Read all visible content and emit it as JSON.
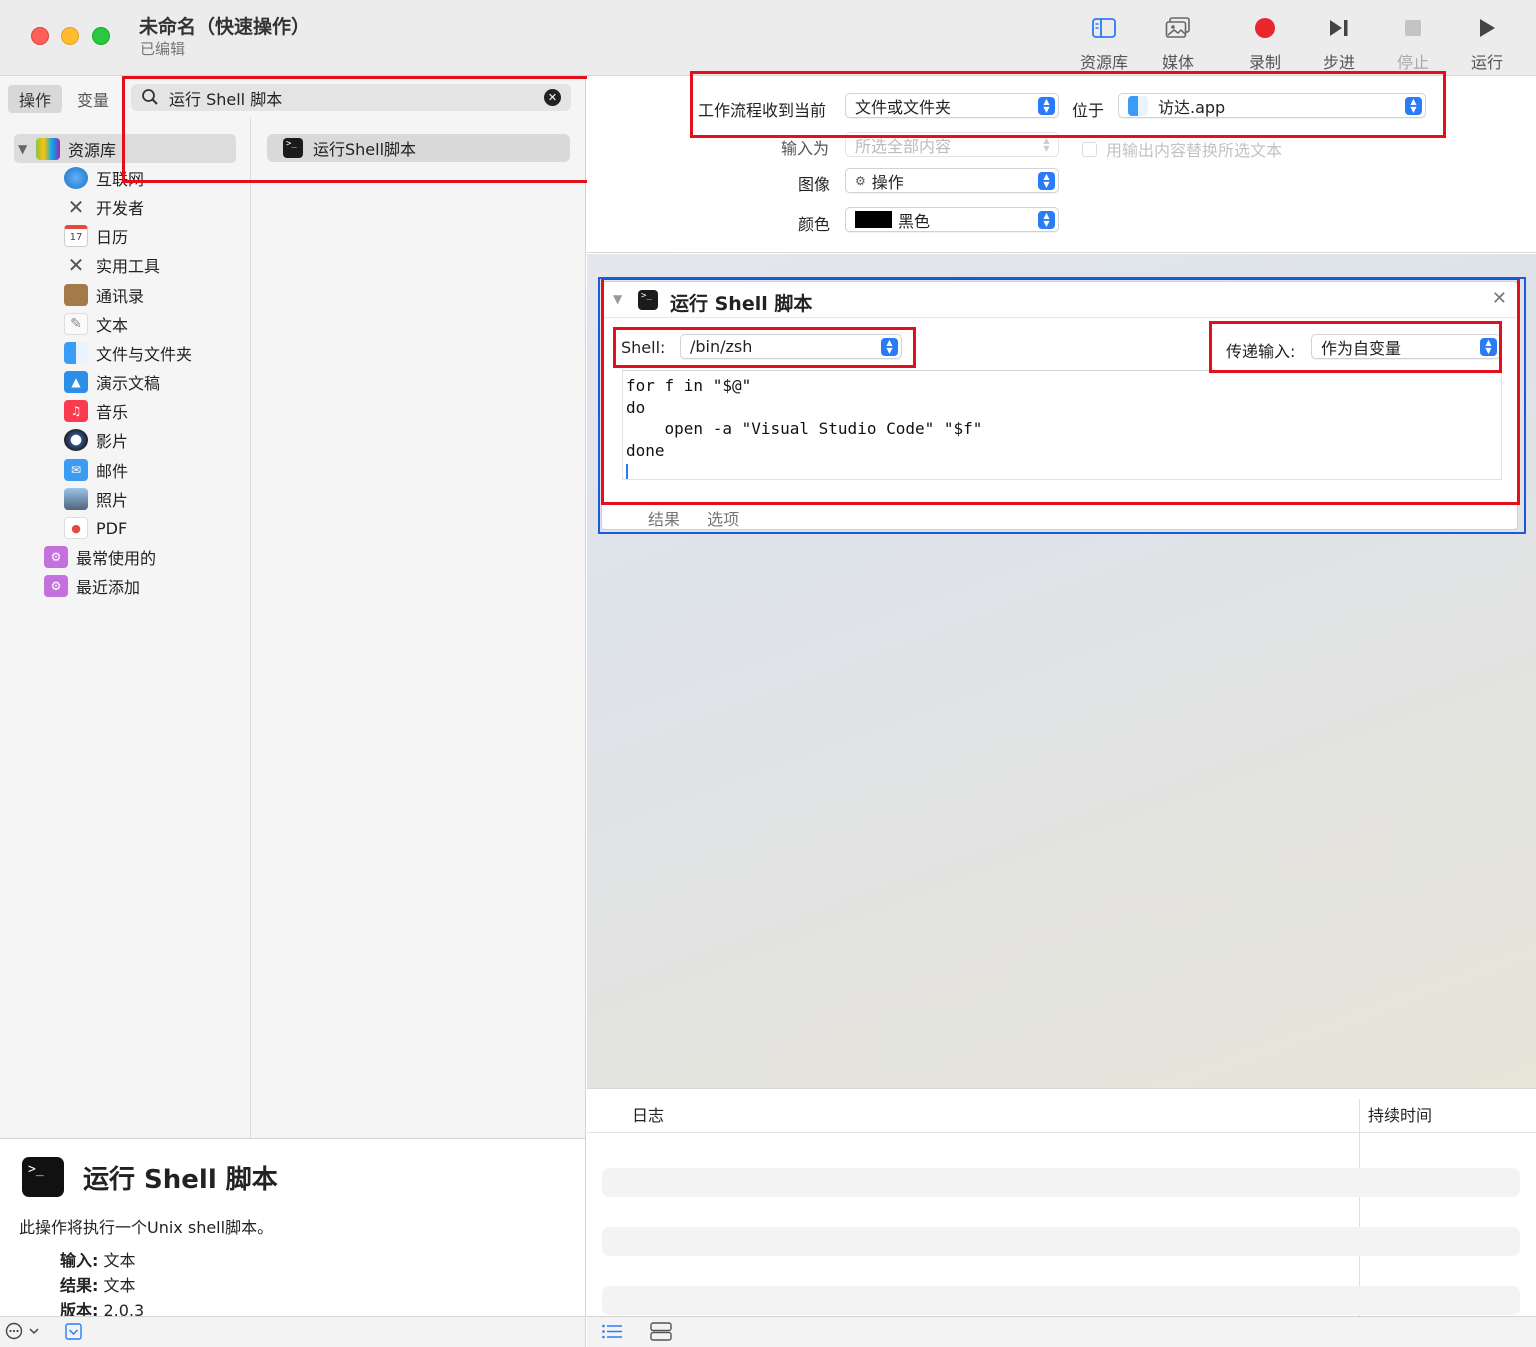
{
  "window": {
    "title": "未命名（快速操作）",
    "subtitle": "已编辑"
  },
  "toolbar": {
    "library": "资源库",
    "media": "媒体",
    "record": "录制",
    "step": "步进",
    "stop": "停止",
    "run": "运行"
  },
  "scope_tabs": [
    "操作",
    "变量"
  ],
  "search": {
    "value": "运行 Shell 脚本"
  },
  "library": {
    "root": "资源库",
    "children": [
      "互联网",
      "开发者",
      "日历",
      "实用工具",
      "通讯录",
      "文本",
      "文件与文件夹",
      "演示文稿",
      "音乐",
      "影片",
      "邮件",
      "照片",
      "PDF"
    ],
    "smart_groups": [
      "最常使用的",
      "最近添加"
    ]
  },
  "actions": [
    "运行Shell脚本"
  ],
  "description": {
    "title": "运行 Shell 脚本",
    "text": "此操作将执行一个Unix shell脚本。",
    "input_label": "输入:",
    "input_value": "文本",
    "result_label": "结果:",
    "result_value": "文本",
    "version_label": "版本:",
    "version_value": "2.0.3"
  },
  "workflow": {
    "receives_label": "工作流程收到当前",
    "receives_value": "文件或文件夹",
    "in_label": "位于",
    "in_value": "访达.app",
    "input_is_label": "输入为",
    "input_is_value": "所选全部内容",
    "replace_label": "用输出内容替换所选文本",
    "image_label": "图像",
    "image_value": "操作",
    "color_label": "颜色",
    "color_value": "黑色"
  },
  "action_card": {
    "title": "运行 Shell 脚本",
    "shell_label": "Shell:",
    "shell_value": "/bin/zsh",
    "pass_label": "传递输入:",
    "pass_value": "作为自变量",
    "script": "for f in \"$@\"\ndo\n    open -a \"Visual Studio Code\" \"$f\"\ndone",
    "tabs": [
      "结果",
      "选项"
    ]
  },
  "log": {
    "col_log": "日志",
    "col_duration": "持续时间"
  },
  "colors": {
    "accent": "#2a7cf6",
    "highlight_red": "#e3101b",
    "highlight_blue": "#1a5bdb",
    "record": "#e8262b"
  }
}
